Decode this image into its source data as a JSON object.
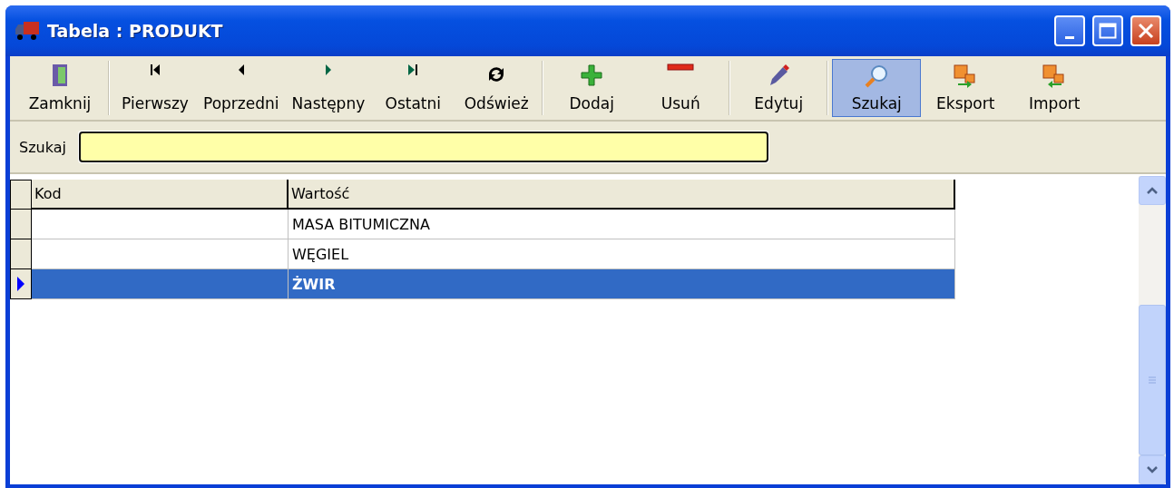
{
  "window": {
    "title": "Tabela : PRODUKT"
  },
  "toolbar": [
    [
      {
        "kind": "close",
        "label": "Zamknij",
        "selected": false
      }
    ],
    [
      {
        "kind": "first",
        "label": "Pierwszy",
        "selected": false
      },
      {
        "kind": "prev",
        "label": "Poprzedni",
        "selected": false
      },
      {
        "kind": "next",
        "label": "Następny",
        "selected": false
      },
      {
        "kind": "last",
        "label": "Ostatni",
        "selected": false
      },
      {
        "kind": "refresh",
        "label": "Odśwież",
        "selected": false
      }
    ],
    [
      {
        "kind": "add",
        "label": "Dodaj",
        "selected": false
      },
      {
        "kind": "remove",
        "label": "Usuń",
        "selected": false
      }
    ],
    [
      {
        "kind": "edit",
        "label": "Edytuj",
        "selected": false
      }
    ],
    [
      {
        "kind": "search",
        "label": "Szukaj",
        "selected": true
      },
      {
        "kind": "export",
        "label": "Eksport",
        "selected": false
      },
      {
        "kind": "import",
        "label": "Import",
        "selected": false
      }
    ]
  ],
  "search": {
    "label": "Szukaj"
  },
  "table": {
    "columns": [
      "Kod",
      "Wartość"
    ],
    "rows": [
      {
        "cells": [
          "",
          "MASA BITUMICZNA"
        ],
        "selected": false
      },
      {
        "cells": [
          "",
          "WĘGIEL"
        ],
        "selected": false
      },
      {
        "cells": [
          "",
          "ŻWIR"
        ],
        "selected": true
      }
    ]
  }
}
